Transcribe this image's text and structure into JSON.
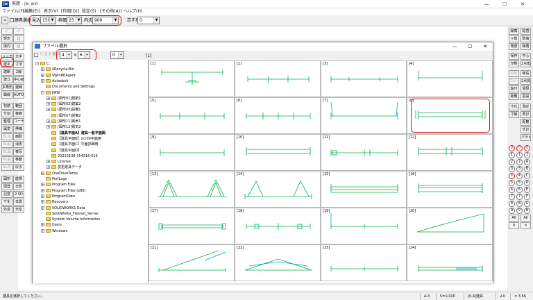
{
  "window": {
    "title": "無題 - jw_win",
    "icon_label": "jw",
    "controls": [
      "—",
      "☐",
      "✕"
    ]
  },
  "menu": [
    "ファイル(F)",
    "[編集(E)]",
    "表示(V)",
    "[作図(D)]",
    "設定(S)",
    "[その他(A)]",
    "ヘルプ(H)"
  ],
  "toolbar": {
    "arrow": ">",
    "mode_label": "建具選択",
    "mikomi_label": "見込",
    "mikomi_value": "150",
    "waku_label": "枠幅",
    "waku_value": "25",
    "nori_label": "内法",
    "nori_value": "900",
    "shin_label": "芯ずれ",
    "shin_value": "0"
  },
  "left_tools": [
    [
      "／",
      "／"
    ],
    [
      "矩形",
      "□"
    ],
    [
      "接円",
      "○"
    ],
    [
      "ハッチ",
      "文字"
    ],
    [
      "建平",
      "寸法"
    ],
    [
      "建断",
      "2線"
    ],
    [
      "建立",
      "中心線"
    ],
    [
      "多角形",
      "連線"
    ],
    [
      "曲線",
      "AUTO"
    ],
    [
      "包絡",
      "範囲"
    ],
    [
      "分割",
      "複線"
    ],
    [
      "整理",
      "コーナー"
    ],
    [
      "属変",
      "伸縮"
    ],
    [
      "BL化",
      "面取"
    ],
    [
      "BL解",
      "消去"
    ],
    [
      "BL属",
      "複写"
    ],
    [
      "BL編",
      "移動"
    ],
    [
      "BL終",
      "戻る"
    ],
    [
      "図形",
      "座標"
    ],
    [
      "図登",
      "日影"
    ],
    [
      "記変",
      "2.5D"
    ],
    [
      "寸化",
      "日影"
    ],
    [
      "外変",
      "天空"
    ]
  ],
  "right_tools": [
    [
      "線角",
      "鉛直"
    ],
    [
      "×角",
      "数値"
    ],
    [
      "角度",
      "線角"
    ],
    [
      "保存",
      "中心"
    ],
    [
      "印刷",
      "2点角"
    ],
    [
      "切取",
      "線長"
    ],
    [
      "コピー",
      "2点長"
    ],
    [
      "貼付",
      "間隔"
    ],
    [
      "距離",
      "基設"
    ],
    [
      "寸化",
      "測定"
    ],
    [
      "寸解",
      "表計"
    ],
    [
      "",
      "距離"
    ],
    [
      "",
      "式計"
    ],
    [
      "",
      "パラメ"
    ]
  ],
  "right_circles": [
    [
      "0",
      "0",
      "0"
    ],
    [
      "1",
      "1",
      "1"
    ],
    [
      "2",
      "2",
      "A"
    ],
    [
      "3",
      "3",
      "B"
    ],
    [
      "4",
      "4",
      "C"
    ],
    [
      "5",
      "5",
      "D"
    ],
    [
      "6",
      "6",
      "E"
    ],
    [
      "7",
      "7",
      "F"
    ],
    [
      "8",
      "8",
      "G"
    ],
    [
      "9",
      "9",
      "H"
    ]
  ],
  "right_all": [
    "All",
    "All"
  ],
  "right_bottom": [
    "0",
    "×"
  ],
  "dialog": {
    "title": "ファイル選択",
    "list_label": "リスト表示",
    "cols": "4",
    "rows": "6",
    "spin_value": "0",
    "folder_caption": "[1]",
    "tree": [
      {
        "label": "C:",
        "indent": 0,
        "exp": "-",
        "bold": false
      },
      {
        "label": "$Recycle.Bin",
        "indent": 1,
        "exp": "+",
        "bold": false
      },
      {
        "label": "$WinREAgent",
        "indent": 1,
        "exp": "+",
        "bold": false
      },
      {
        "label": "Autodesk",
        "indent": 1,
        "exp": "+",
        "bold": false
      },
      {
        "label": "Documents and Settings",
        "indent": 1,
        "exp": "",
        "bold": false
      },
      {
        "label": "JWW",
        "indent": 1,
        "exp": "-",
        "bold": false
      },
      {
        "label": "[図形01]建築1",
        "indent": 2,
        "exp": "+",
        "bold": false
      },
      {
        "label": "[図形02]建築2",
        "indent": 2,
        "exp": "+",
        "bold": false
      },
      {
        "label": "[図形03]設備1",
        "indent": 2,
        "exp": "+",
        "bold": false
      },
      {
        "label": "[図形07]設備2",
        "indent": 2,
        "exp": "",
        "bold": false
      },
      {
        "label": "[図形11]電気1",
        "indent": 2,
        "exp": "+",
        "bold": false
      },
      {
        "label": "[図形12]電気2",
        "indent": 2,
        "exp": "+",
        "bold": false
      },
      {
        "label": "【建具平面A】建具一般平面図",
        "indent": 2,
        "exp": "",
        "bold": true
      },
      {
        "label": "【建具平面B】1/100平面用",
        "indent": 2,
        "exp": "",
        "bold": false
      },
      {
        "label": "【建具平面C】平面詳細用",
        "indent": 2,
        "exp": "",
        "bold": false
      },
      {
        "label": "【建具平面D】",
        "indent": 2,
        "exp": "",
        "bold": false
      },
      {
        "label": "20210108-154316-016",
        "indent": 2,
        "exp": "",
        "bold": false
      },
      {
        "label": "License",
        "indent": 2,
        "exp": "+",
        "bold": false
      },
      {
        "label": "変更建具データ",
        "indent": 2,
        "exp": "+",
        "bold": false
      },
      {
        "label": "OneDriveTemp",
        "indent": 1,
        "exp": "+",
        "bold": false
      },
      {
        "label": "PerfLogs",
        "indent": 1,
        "exp": "",
        "bold": false
      },
      {
        "label": "Program Files",
        "indent": 1,
        "exp": "+",
        "bold": false
      },
      {
        "label": "Program Files (x86)",
        "indent": 1,
        "exp": "+",
        "bold": false
      },
      {
        "label": "ProgramData",
        "indent": 1,
        "exp": "+",
        "bold": false
      },
      {
        "label": "Recovery",
        "indent": 1,
        "exp": "+",
        "bold": false
      },
      {
        "label": "SOLIDWORKS Data",
        "indent": 1,
        "exp": "+",
        "bold": false
      },
      {
        "label": "SolidWorks_Flexnet_Server",
        "indent": 1,
        "exp": "",
        "bold": false
      },
      {
        "label": "System Volume Information",
        "indent": 1,
        "exp": "",
        "bold": false
      },
      {
        "label": "Users",
        "indent": 1,
        "exp": "+",
        "bold": false
      },
      {
        "label": "Windows",
        "indent": 1,
        "exp": "+",
        "bold": false
      }
    ],
    "cells": [
      "[1]",
      "[2]",
      "[3]",
      "[4]",
      "[5]",
      "[6]",
      "[7]",
      "[8]",
      "[9]",
      "[10]",
      "[11]",
      "[12]",
      "[13]",
      "[14]",
      "[15]",
      "[16]",
      "[17]",
      "[18]",
      "[19]",
      "[20]",
      "[21]",
      "[22]",
      "[23]",
      "[24]"
    ],
    "selected_cell": 8
  },
  "status": {
    "message": "建具を選択してください。",
    "paper": "A-3",
    "scale": "S=1/100",
    "layer": "[0-4]建具",
    "angle": "∠0",
    "zoom": "× 3.56"
  },
  "colors": {
    "line": "#00b050",
    "highlight": "#d11111",
    "cyan": "#00a0c8"
  }
}
